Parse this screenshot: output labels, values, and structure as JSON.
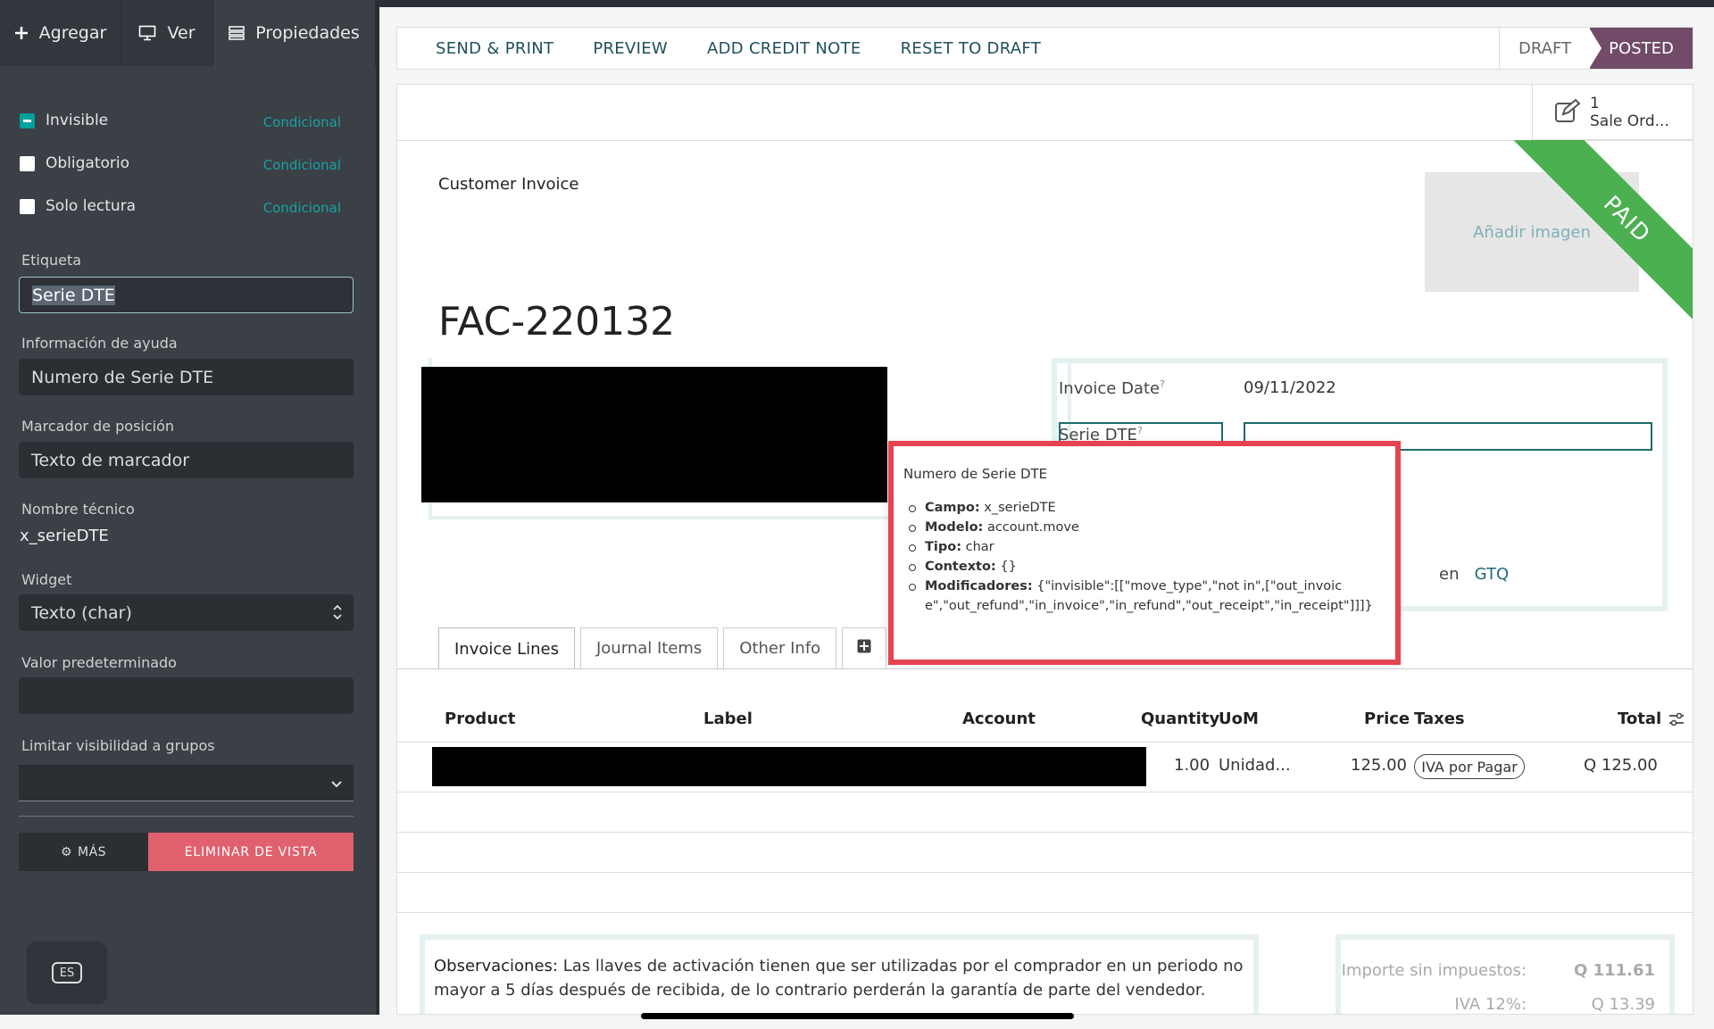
{
  "sidebar": {
    "tabs": [
      {
        "label": "Agregar",
        "icon": "plus-icon"
      },
      {
        "label": "Ver",
        "icon": "monitor-icon"
      },
      {
        "label": "Propiedades",
        "icon": "properties-icon"
      }
    ],
    "options": [
      {
        "label": "Invisible",
        "cond": "Condicional",
        "state": "indeterminate"
      },
      {
        "label": "Obligatorio",
        "cond": "Condicional",
        "state": "unchecked"
      },
      {
        "label": "Solo lectura",
        "cond": "Condicional",
        "state": "unchecked"
      }
    ],
    "etiqueta_label": "Etiqueta",
    "etiqueta_value": "Serie DTE",
    "ayuda_label": "Información de ayuda",
    "ayuda_value": "Numero de Serie DTE",
    "marcador_label": "Marcador de posición",
    "marcador_value": "Texto de marcador",
    "nombre_label": "Nombre técnico",
    "nombre_value": "x_serieDTE",
    "widget_label": "Widget",
    "widget_value": "Texto (char)",
    "valor_label": "Valor predeterminado",
    "valor_value": "",
    "grupos_label": "Limitar visibilidad a grupos",
    "grupos_value": "",
    "mas_label": "MÁS",
    "eliminar_label": "ELIMINAR DE VISTA",
    "lang": "ES"
  },
  "actions": [
    "SEND & PRINT",
    "PREVIEW",
    "ADD CREDIT NOTE",
    "RESET TO DRAFT"
  ],
  "status": {
    "draft": "DRAFT",
    "posted": "POSTED"
  },
  "smart_button": {
    "count": "1",
    "label": "Sale Ord..."
  },
  "doc": {
    "type": "Customer Invoice",
    "image_placeholder": "Añadir imagen",
    "ribbon": "PAID",
    "name": "FAC-220132",
    "invoice_date_label": "Invoice Date",
    "invoice_date_value": "09/11/2022",
    "serie_label": "Serie DTE",
    "currency_prefix": "en",
    "currency": "GTQ"
  },
  "tooltip": {
    "title": "Numero de Serie DTE",
    "items": [
      {
        "key": "Campo:",
        "value": "x_serieDTE"
      },
      {
        "key": "Modelo:",
        "value": "account.move"
      },
      {
        "key": "Tipo:",
        "value": "char"
      },
      {
        "key": "Contexto:",
        "value": "{}"
      },
      {
        "key": "Modificadores:",
        "value": "{\"invisible\":[[\"move_type\",\"not in\",[\"out_invoice\",\"out_refund\",\"in_invoice\",\"in_refund\",\"out_receipt\",\"in_receipt\"]]]}"
      }
    ]
  },
  "tabs": [
    "Invoice Lines",
    "Journal Items",
    "Other Info"
  ],
  "table": {
    "headers": [
      "Product",
      "Label",
      "Account",
      "Quantity",
      "UoM",
      "Price",
      "Taxes",
      "Total"
    ],
    "row": {
      "quantity": "1.00",
      "uom": "Unidad...",
      "price": "125.00",
      "tax": "IVA por Pagar",
      "total": "Q 125.00"
    }
  },
  "observaciones": {
    "label": "Observaciones:",
    "text": "Las llaves de activación tienen que ser utilizadas por el comprador en un periodo no mayor a 5 días después de recibida, de lo contrario perderán la garantía de parte del vendedor."
  },
  "totals": [
    {
      "label": "Importe sin impuestos:",
      "value": "Q 111.61"
    },
    {
      "label": "IVA 12%:",
      "value": "Q 13.39"
    }
  ],
  "colors": {
    "accent": "#00a09d",
    "posted": "#714b67",
    "paid": "#4caf50",
    "danger": "#e0606d",
    "highlight": "#e4434f"
  }
}
